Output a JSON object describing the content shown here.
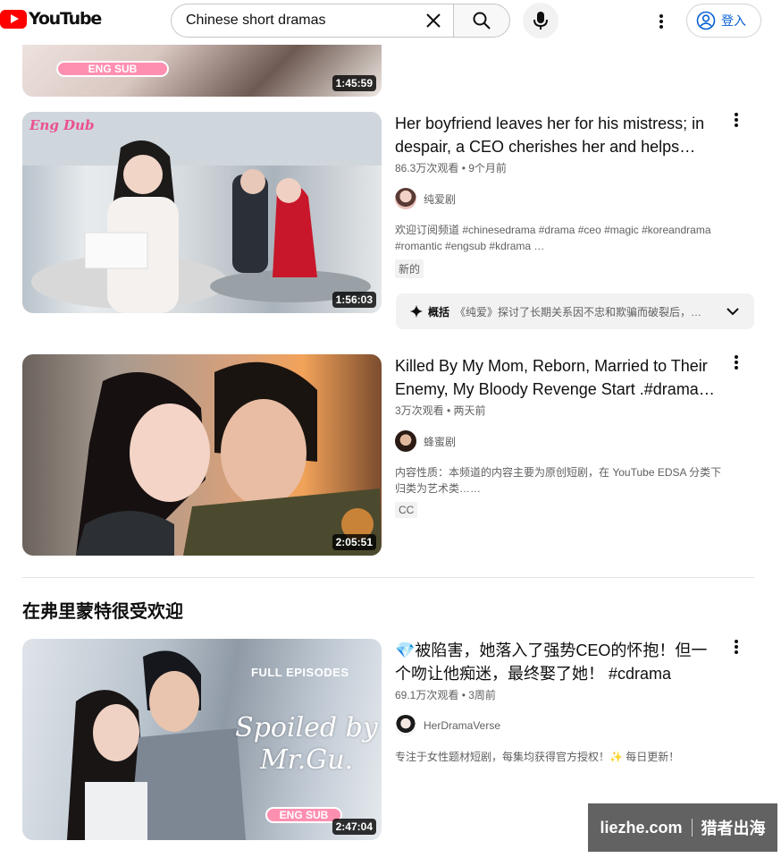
{
  "header": {
    "logo_text": "YouTube",
    "search_value": "Chinese short dramas",
    "signin_label": "登入"
  },
  "videos": [
    {
      "duration": "1:45:59",
      "thumb_label": "ENG SUB"
    },
    {
      "title": "Her boyfriend leaves her for his mistress; in despair, a CEO cherishes her and helps her…",
      "meta": "86.3万次观看 • 9个月前",
      "channel": "纯爱剧",
      "description": "欢迎订阅频道 #chinesedrama #drama #ceo #magic #koreandrama #romantic #engsub #kdrama …",
      "badge": "新的",
      "duration": "1:56:03",
      "thumb_label": "Eng Dub",
      "summary_label": "概括",
      "summary_text": "《纯爱》探讨了长期关系因不忠和欺骗而破裂后，背…"
    },
    {
      "title": "Killed By My Mom, Reborn, Married to Their Enemy, My Bloody Revenge Start .#drama…",
      "meta": "3万次观看 • 两天前",
      "channel": "蜂蜜剧",
      "description": "内容性质：本频道的内容主要为原创短剧，在 YouTube EDSA 分类下归类为艺术类……",
      "badge": "CC",
      "duration": "2:05:51"
    },
    {
      "title": "💎被陷害，她落入了强势CEO的怀抱！但一个吻让他痴迷，最终娶了她！ #cdrama",
      "meta": "69.1万次观看 • 3周前",
      "channel": "HerDramaVerse",
      "description": "专注于女性题材短剧，每集均获得官方授权！✨ 每日更新！",
      "duration": "2:47:04",
      "thumb_top_label": "FULL EPISODES",
      "thumb_script": "Spoiled by Mr.Gu.",
      "thumb_label": "ENG SUB"
    }
  ],
  "shelf": {
    "title": "在弗里蒙特很受欢迎"
  },
  "watermark": {
    "left": "liezhe.com",
    "right": "猎者出海"
  }
}
